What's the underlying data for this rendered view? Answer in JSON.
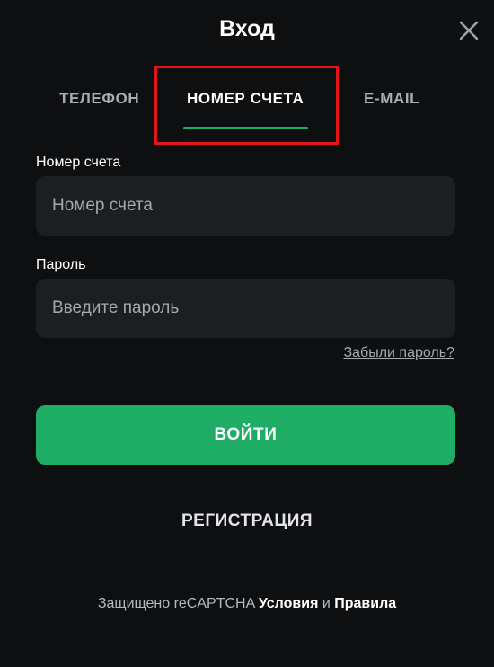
{
  "header": {
    "title": "Вход",
    "close_icon": "close-icon"
  },
  "tabs": [
    {
      "label": "ТЕЛЕФОН",
      "active": false
    },
    {
      "label": "НОМЕР СЧЕТА",
      "active": true
    },
    {
      "label": "E-MAIL",
      "active": false
    }
  ],
  "form": {
    "account_label": "Номер счета",
    "account_placeholder": "Номер счета",
    "account_value": "",
    "password_label": "Пароль",
    "password_placeholder": "Введите пароль",
    "password_value": "",
    "forgot_link": "Забыли пароль?",
    "login_button": "ВОЙТИ",
    "register_link": "РЕГИСТРАЦИЯ"
  },
  "footer": {
    "prefix": "Защищено reCAPTCHA",
    "terms_link": "Условия",
    "conjunction": "и",
    "privacy_link": "Правила"
  },
  "colors": {
    "background": "#0e0f11",
    "field_background": "#1c1e22",
    "accent": "#1fad66",
    "highlight": "#e5141a"
  }
}
